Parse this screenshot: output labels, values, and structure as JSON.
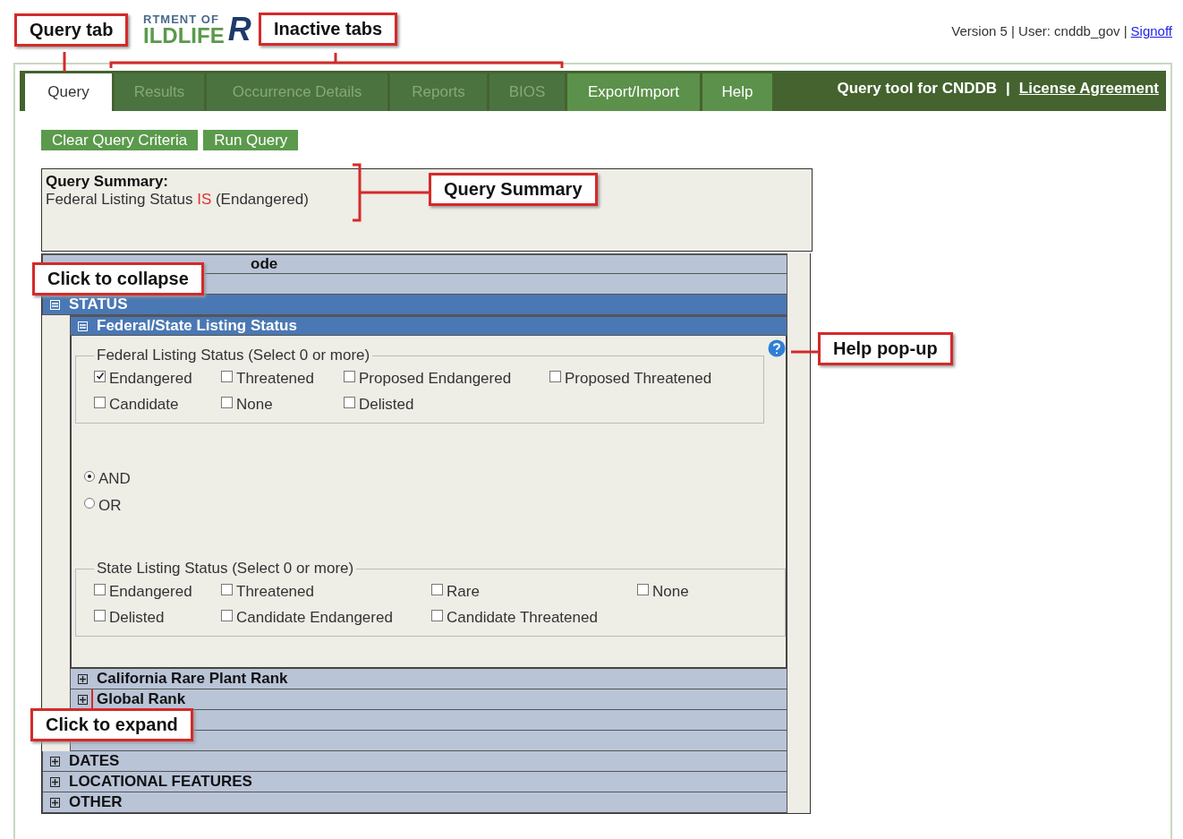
{
  "header": {
    "logo_top": "RTMENT OF",
    "logo_bottom": "ILDLIFE",
    "logo_mark": "R",
    "account": "Version 5 | User: cnddb_gov |",
    "signoff": "Signoff"
  },
  "tabs": [
    {
      "label": "Query",
      "selected": true,
      "disabled": false
    },
    {
      "label": "Results",
      "selected": false,
      "disabled": true
    },
    {
      "label": "Occurrence Details",
      "selected": false,
      "disabled": true
    },
    {
      "label": "Reports",
      "selected": false,
      "disabled": true
    },
    {
      "label": "BIOS",
      "selected": false,
      "disabled": true
    },
    {
      "label": "Export/Import",
      "selected": false,
      "disabled": false
    },
    {
      "label": "Help",
      "selected": false,
      "disabled": false
    }
  ],
  "toolbar": {
    "title": "Query tool for CNDDB",
    "separator": "|",
    "link": "License Agreement"
  },
  "buttons": [
    "Clear Query Criteria",
    "Run Query"
  ],
  "summary": {
    "title": "Query Summary:",
    "field": "Federal Listing Status",
    "operator": "IS",
    "value": "(Endangered)"
  },
  "sections": [
    {
      "kind": "partial",
      "label": "ode"
    },
    {
      "kind": "blank"
    },
    {
      "kind": "group",
      "label": "STATUS",
      "expanded": true,
      "children": [
        {
          "kind": "panel",
          "label": "Federal/State Listing Status",
          "expanded": true,
          "fieldsets": [
            {
              "kind": "federal",
              "legend": "Federal Listing Status (Select 0 or more)",
              "options": [
                {
                  "label": "Endangered",
                  "checked": true
                },
                {
                  "label": "Threatened",
                  "checked": false
                },
                {
                  "label": "Proposed Endangered",
                  "checked": false
                },
                {
                  "label": "Proposed Threatened",
                  "checked": false
                },
                {
                  "label": "Candidate",
                  "checked": false
                },
                {
                  "label": "None",
                  "checked": false
                },
                {
                  "label": "Delisted",
                  "checked": false
                }
              ]
            },
            {
              "kind": "state",
              "legend": "State Listing Status (Select 0 or more)",
              "options": [
                {
                  "label": "Endangered",
                  "checked": false
                },
                {
                  "label": "Threatened",
                  "checked": false
                },
                {
                  "label": "Rare",
                  "checked": false
                },
                {
                  "label": "None",
                  "checked": false
                },
                {
                  "label": "Delisted",
                  "checked": false
                },
                {
                  "label": "Candidate Endangered",
                  "checked": false
                },
                {
                  "label": "Candidate Threatened",
                  "checked": false
                }
              ]
            }
          ],
          "operators": [
            {
              "label": "AND",
              "selected": true
            },
            {
              "label": "OR",
              "selected": false
            }
          ]
        },
        {
          "kind": "row",
          "label": "California Rare Plant Rank",
          "expanded": false
        },
        {
          "kind": "row",
          "label": "Global Rank",
          "expanded": false
        },
        {
          "kind": "blank"
        },
        {
          "kind": "blank"
        }
      ]
    },
    {
      "kind": "row",
      "label": "DATES",
      "expanded": false
    },
    {
      "kind": "row",
      "label": "LOCATIONAL FEATURES",
      "expanded": false
    },
    {
      "kind": "row",
      "label": "OTHER",
      "expanded": false
    }
  ],
  "annotations": [
    "Query tab",
    "Inactive tabs",
    "Query Summary",
    "Click to collapse",
    "Help pop-up",
    "Click to expand"
  ]
}
